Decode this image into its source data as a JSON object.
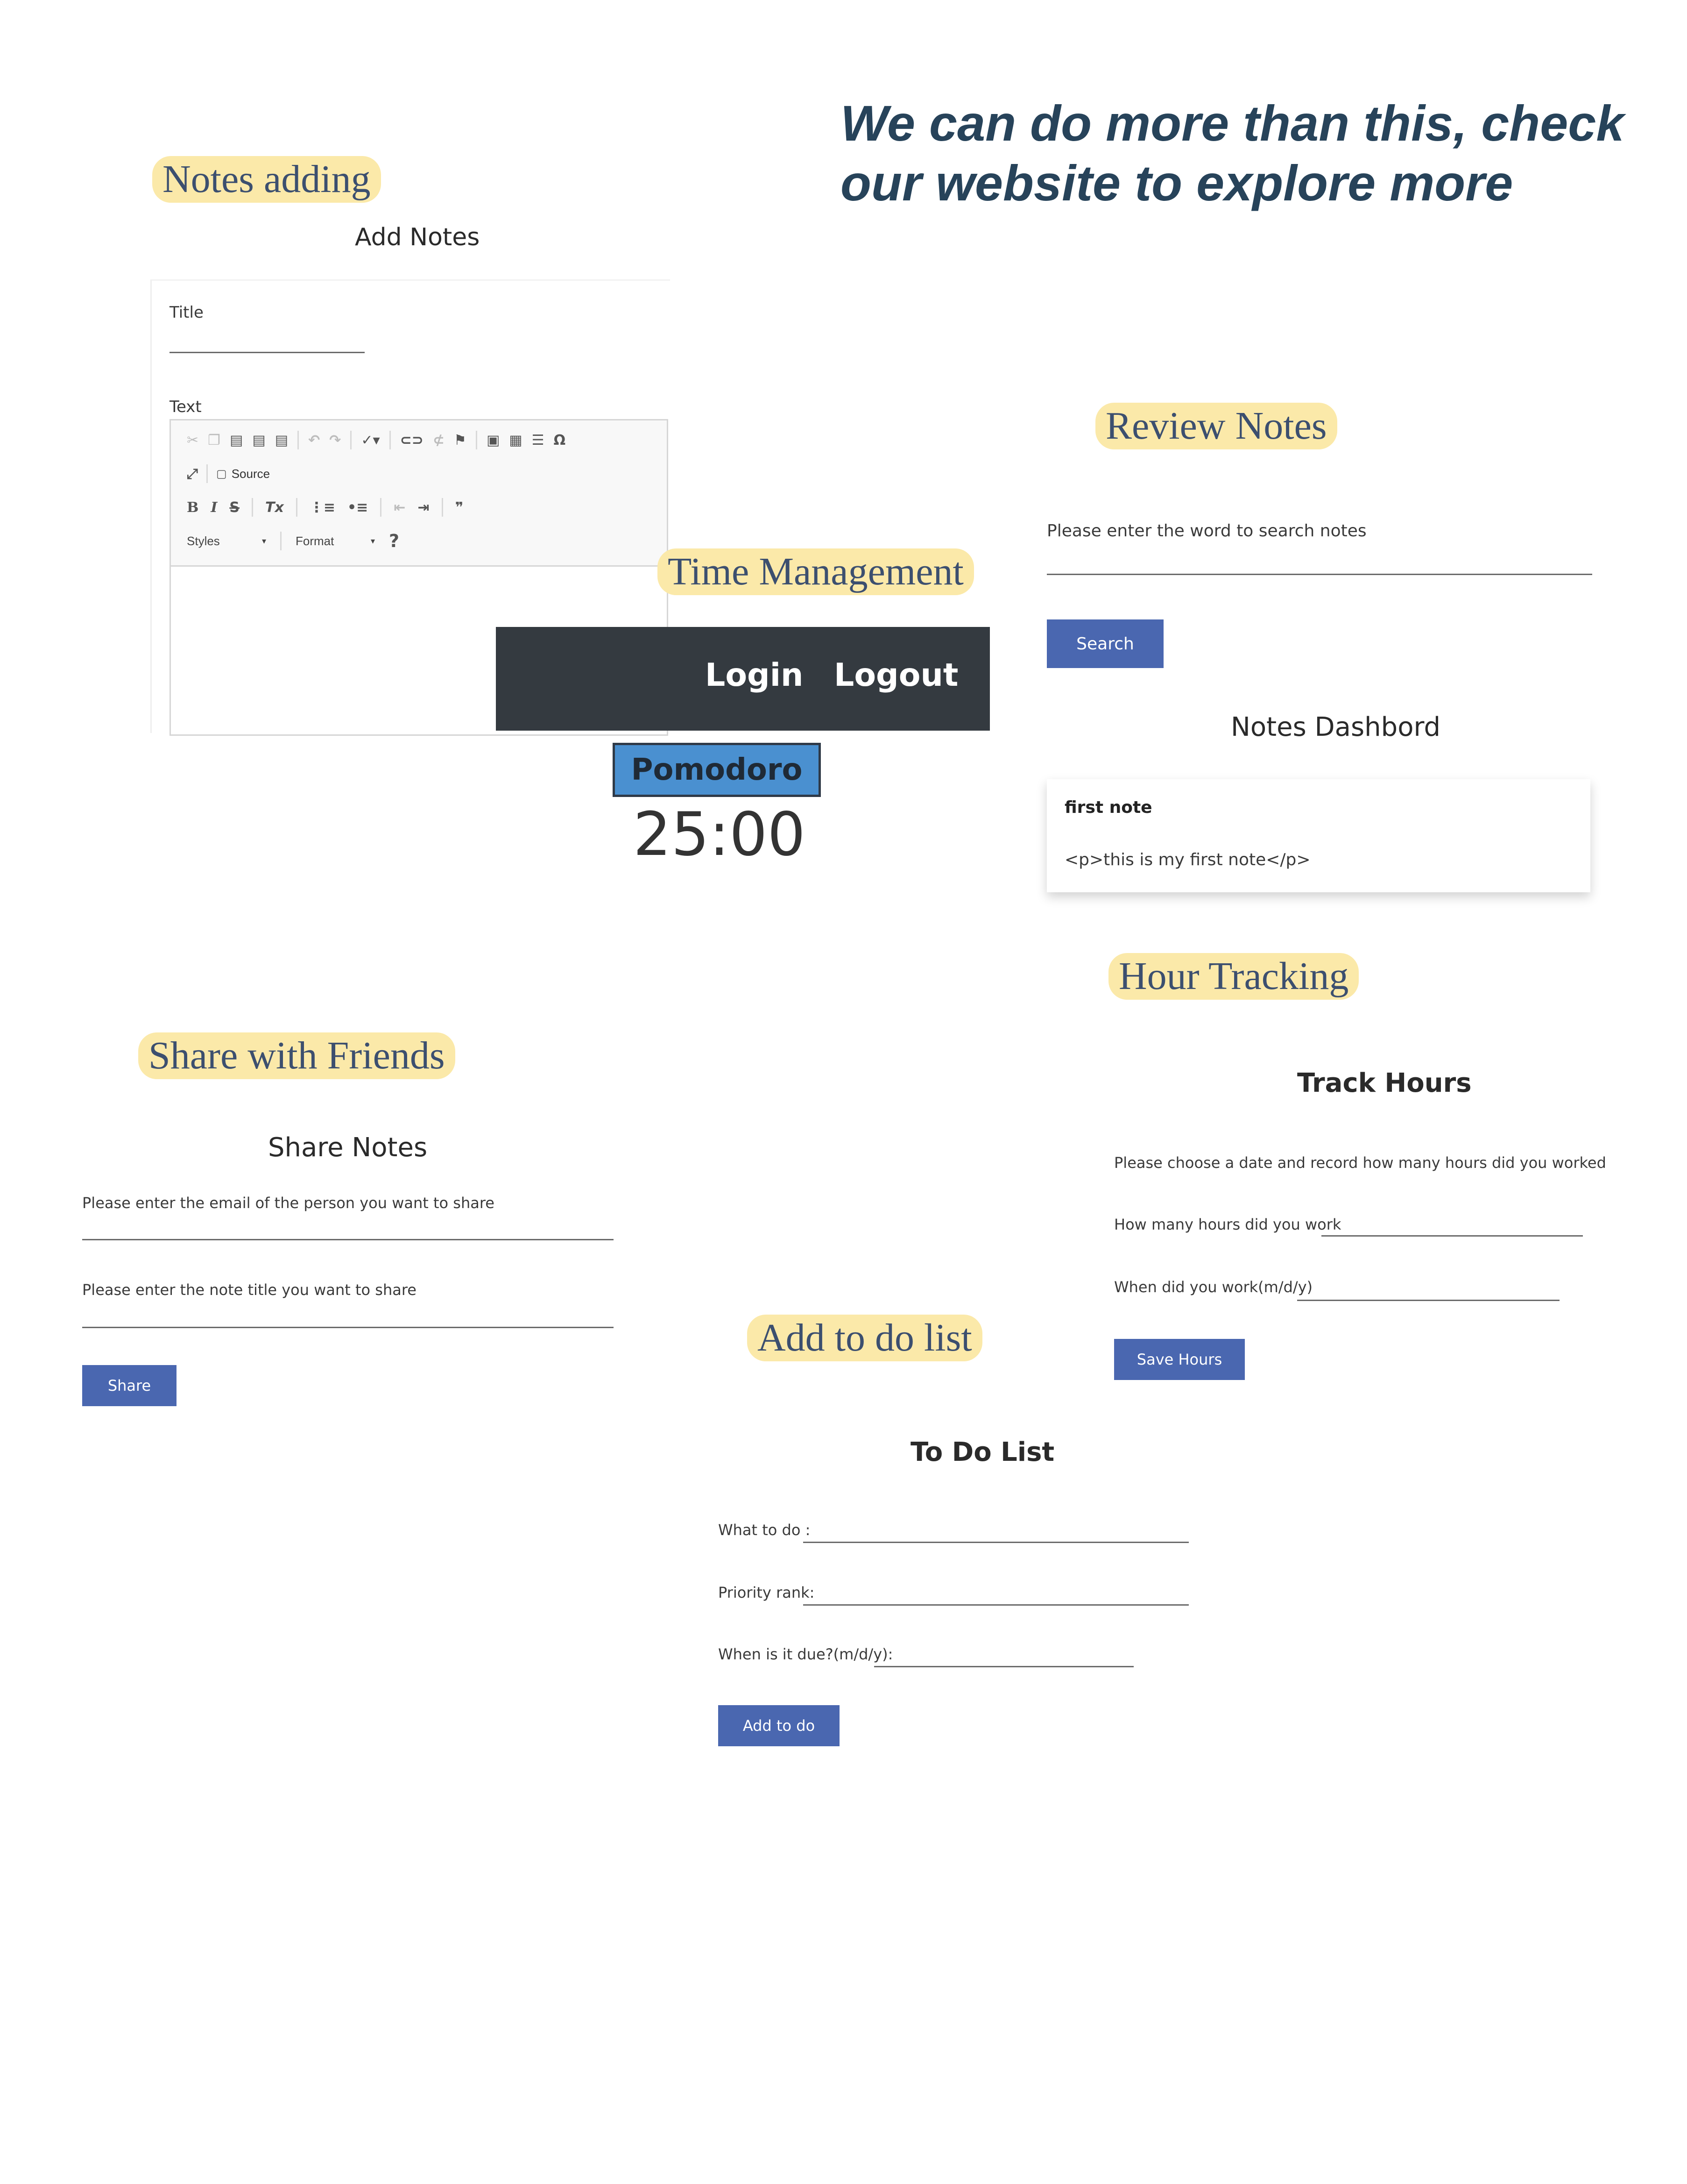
{
  "tagline": {
    "line1": "We can do more than this, check",
    "line2": "our website to explore more"
  },
  "sections": {
    "notes_adding": "Notes adding",
    "review_notes": "Review Notes",
    "time_management": "Time Management",
    "hour_tracking": "Hour  Tracking",
    "share_friends": "Share with Friends",
    "todo": "Add to do list"
  },
  "add_notes": {
    "heading": "Add Notes",
    "title_label": "Title",
    "text_label": "Text",
    "toolbar": {
      "row1_icons": [
        "cut-icon",
        "copy-icon",
        "paste-icon",
        "paste-text-icon",
        "paste-word-icon",
        "undo-icon",
        "redo-icon",
        "spellcheck-icon",
        "link-icon",
        "unlink-icon",
        "anchor-icon",
        "image-icon",
        "table-icon",
        "horizontal-line-icon",
        "special-char-icon"
      ],
      "source_label": "Source",
      "bold": "B",
      "italic": "I",
      "strike": "S",
      "remove_format": "Tx",
      "styles_label": "Styles",
      "format_label": "Format",
      "help": "?"
    }
  },
  "review": {
    "search_label": "Please enter the word to search notes",
    "search_value": "",
    "search_button": "Search",
    "dashboard_heading": "Notes Dashbord",
    "notes": [
      {
        "title": "first note",
        "body": "<p>this is my first note</p>"
      }
    ]
  },
  "timer": {
    "nav_login": "Login",
    "nav_logout": "Logout",
    "pomodoro_label": "Pomodoro",
    "time": "25:00"
  },
  "track_hours": {
    "heading": "Track Hours",
    "instruction": "Please choose a date and record how many hours did you worked",
    "hours_label": "How many hours did you work",
    "date_label": "When did you work(m/d/y)",
    "save_button": "Save Hours"
  },
  "share": {
    "heading": "Share Notes",
    "email_label": "Please enter the email of the person you want to share",
    "title_label": "Please enter the note title you want to share",
    "share_button": "Share"
  },
  "todo_list": {
    "heading": "To Do List",
    "what_label": "What to do :",
    "priority_label": "Priority rank:",
    "due_label": "When is it due?(m/d/y):",
    "add_button": "Add to do"
  },
  "colors": {
    "accent_button": "#4a67b0",
    "highlight": "#fbe9a9",
    "navbar": "#343a40",
    "pomodoro": "#4a90d0"
  }
}
